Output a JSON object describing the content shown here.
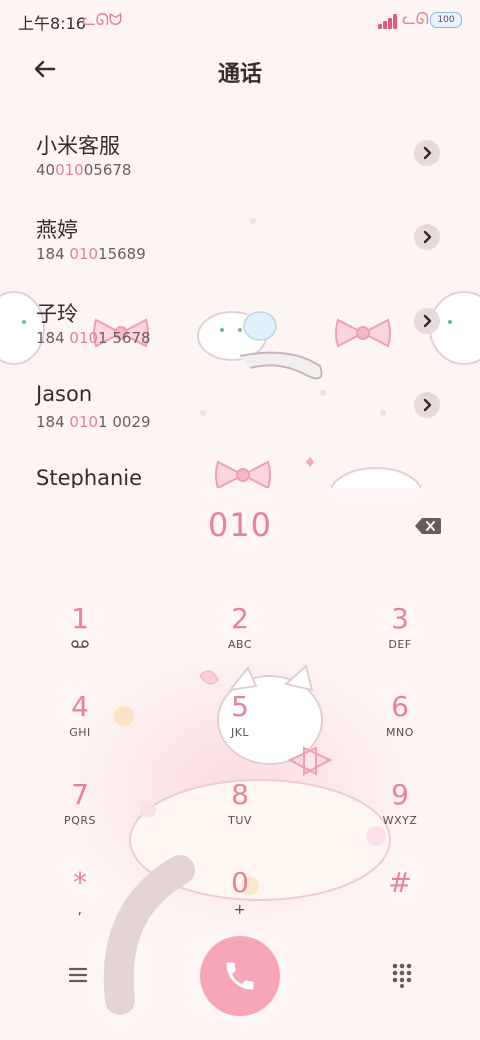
{
  "status_bar": {
    "time": "上午8:16",
    "battery": "100"
  },
  "header": {
    "title": "通话"
  },
  "contacts": [
    {
      "name": "小米客服",
      "num_pre": "40",
      "num_hl": "010",
      "num_post": "05678"
    },
    {
      "name": "燕婷",
      "num_pre": "184 ",
      "num_hl": "010",
      "num_post": "15689"
    },
    {
      "name": "子玲",
      "num_pre": "184 ",
      "num_hl": "010",
      "num_post": "1 5678"
    },
    {
      "name": "Jason",
      "num_pre": "184 ",
      "num_hl": "010",
      "num_post": "1 0029"
    },
    {
      "name": "Stephanie",
      "num_pre": "",
      "num_hl": "",
      "num_post": ""
    }
  ],
  "dialer": {
    "digits": "010",
    "keys": [
      {
        "digit": "1",
        "sub": ""
      },
      {
        "digit": "2",
        "sub": "ABC"
      },
      {
        "digit": "3",
        "sub": "DEF"
      },
      {
        "digit": "4",
        "sub": "GHI"
      },
      {
        "digit": "5",
        "sub": "JKL"
      },
      {
        "digit": "6",
        "sub": "MNO"
      },
      {
        "digit": "7",
        "sub": "PQRS"
      },
      {
        "digit": "8",
        "sub": "TUV"
      },
      {
        "digit": "9",
        "sub": "WXYZ"
      },
      {
        "digit": "*",
        "sub": ","
      },
      {
        "digit": "0",
        "sub": "+"
      },
      {
        "digit": "#",
        "sub": ""
      }
    ]
  },
  "colors": {
    "accent": "#e8829c",
    "call_button": "#f6a6b4",
    "background": "#fdf5f3"
  },
  "icons": [
    "back-arrow-icon",
    "chevron-right-icon",
    "backspace-icon",
    "voicemail-icon",
    "menu-icon",
    "phone-icon",
    "dialpad-icon"
  ]
}
